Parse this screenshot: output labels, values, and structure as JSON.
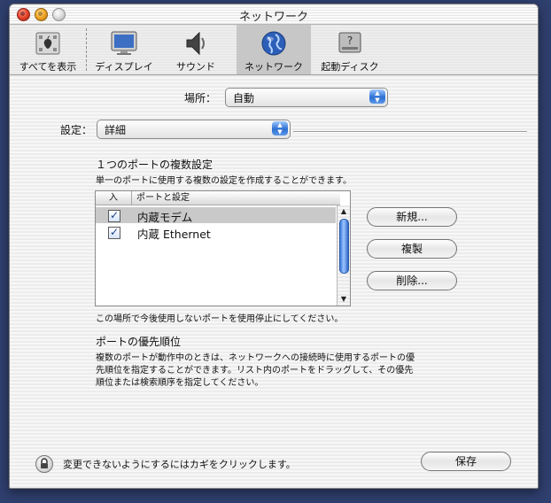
{
  "window": {
    "title": "ネットワーク"
  },
  "toolbar": {
    "items": [
      {
        "label": "すべてを表示",
        "icon": "show-all-icon"
      },
      {
        "label": "ディスプレイ",
        "icon": "display-icon"
      },
      {
        "label": "サウンド",
        "icon": "sound-icon"
      },
      {
        "label": "ネットワーク",
        "icon": "network-globe-icon",
        "selected": true
      },
      {
        "label": "起動ディスク",
        "icon": "startup-disk-icon"
      }
    ]
  },
  "location": {
    "label": "場所：",
    "value": "自動"
  },
  "show": {
    "label": "設定：",
    "value": "詳細"
  },
  "multi": {
    "heading": "１つのポートの複数設定",
    "description": "単一のポートに使用する複数の設定を作成することができます。"
  },
  "ports_table": {
    "col_on": "入",
    "col_port": "ポートと設定",
    "rows": [
      {
        "label": "内蔵モデム",
        "checked": true,
        "selected": true
      },
      {
        "label": "内蔵 Ethernet",
        "checked": true,
        "selected": false
      }
    ]
  },
  "buttons": {
    "new": "新規...",
    "duplicate": "複製",
    "delete": "削除...",
    "save": "保存"
  },
  "note": "この場所で今後使用しないポートを使用停止にしてください。",
  "priority": {
    "heading": "ポートの優先順位",
    "line1": "複数のポートが動作中のときは、ネットワークへの接続時に使用するポートの優",
    "line2": "先順位を指定することができます。リスト内のポートをドラッグして、その優先",
    "line3": "順位または検索順序を指定してください。"
  },
  "lock_text": "変更できないようにするにはカギをクリックします。",
  "colors": {
    "accent": "#3a7be0",
    "selected_row": "#c9c9c9",
    "desktop": "#2f3f6e"
  }
}
